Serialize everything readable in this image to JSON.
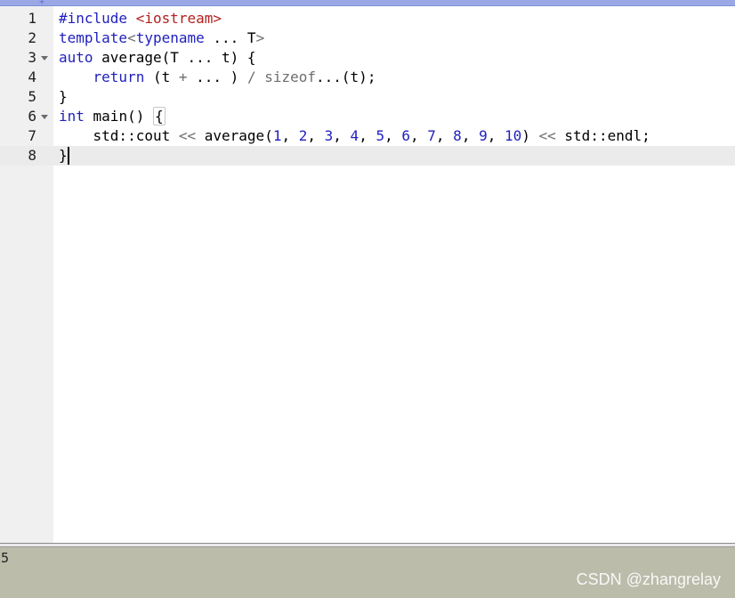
{
  "topbar": {
    "marker": "+"
  },
  "editor": {
    "lines": [
      {
        "num": "1",
        "fold": false,
        "tokens": [
          {
            "t": "#include ",
            "c": "pp"
          },
          {
            "t": "<iostream>",
            "c": "str"
          }
        ]
      },
      {
        "num": "2",
        "fold": false,
        "tokens": [
          {
            "t": "template",
            "c": "kw"
          },
          {
            "t": "<",
            "c": "op"
          },
          {
            "t": "typename",
            "c": "kw"
          },
          {
            "t": " ... T",
            "c": ""
          },
          {
            "t": ">",
            "c": "op"
          }
        ]
      },
      {
        "num": "3",
        "fold": true,
        "tokens": [
          {
            "t": "auto",
            "c": "kw"
          },
          {
            "t": " average(T ... t) {",
            "c": ""
          }
        ]
      },
      {
        "num": "4",
        "fold": false,
        "tokens": [
          {
            "t": "    ",
            "c": ""
          },
          {
            "t": "return",
            "c": "kw"
          },
          {
            "t": " (t ",
            "c": ""
          },
          {
            "t": "+",
            "c": "op"
          },
          {
            "t": " ... ) ",
            "c": ""
          },
          {
            "t": "/",
            "c": "op"
          },
          {
            "t": " ",
            "c": ""
          },
          {
            "t": "sizeof",
            "c": "fn"
          },
          {
            "t": "...(t);",
            "c": ""
          }
        ]
      },
      {
        "num": "5",
        "fold": false,
        "tokens": [
          {
            "t": "}",
            "c": ""
          }
        ]
      },
      {
        "num": "6",
        "fold": true,
        "tokens": [
          {
            "t": "int",
            "c": "kw"
          },
          {
            "t": " main() ",
            "c": ""
          },
          {
            "t": "{",
            "c": "box"
          }
        ]
      },
      {
        "num": "7",
        "fold": false,
        "tokens": [
          {
            "t": "    std::cout ",
            "c": ""
          },
          {
            "t": "<<",
            "c": "op"
          },
          {
            "t": " average(",
            "c": ""
          },
          {
            "t": "1",
            "c": "num"
          },
          {
            "t": ", ",
            "c": ""
          },
          {
            "t": "2",
            "c": "num"
          },
          {
            "t": ", ",
            "c": ""
          },
          {
            "t": "3",
            "c": "num"
          },
          {
            "t": ", ",
            "c": ""
          },
          {
            "t": "4",
            "c": "num"
          },
          {
            "t": ", ",
            "c": ""
          },
          {
            "t": "5",
            "c": "num"
          },
          {
            "t": ", ",
            "c": ""
          },
          {
            "t": "6",
            "c": "num"
          },
          {
            "t": ", ",
            "c": ""
          },
          {
            "t": "7",
            "c": "num"
          },
          {
            "t": ", ",
            "c": ""
          },
          {
            "t": "8",
            "c": "num"
          },
          {
            "t": ", ",
            "c": ""
          },
          {
            "t": "9",
            "c": "num"
          },
          {
            "t": ", ",
            "c": ""
          },
          {
            "t": "10",
            "c": "num"
          },
          {
            "t": ") ",
            "c": ""
          },
          {
            "t": "<<",
            "c": "op"
          },
          {
            "t": " std::endl;",
            "c": ""
          }
        ]
      },
      {
        "num": "8",
        "fold": false,
        "active": true,
        "tokens": [
          {
            "t": "}",
            "c": ""
          }
        ]
      }
    ]
  },
  "output": {
    "text": "5"
  },
  "watermark": "CSDN @zhangrelay",
  "colors": {
    "keyword": "#1f1fbd",
    "string": "#b0221f",
    "operator": "#6e6e6e",
    "gutter": "#f0f0f0",
    "output_bg": "#bcbcab",
    "topbar": "#9aa8e6"
  }
}
